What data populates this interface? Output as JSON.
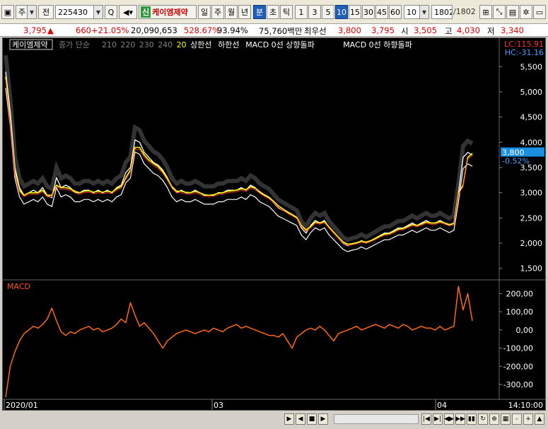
{
  "toolbar": {
    "market_label": "주",
    "jeon_label": "전",
    "code": "225430",
    "sin_label": "신",
    "stock_name": "케이엠제약",
    "period_tabs": [
      "일",
      "주",
      "월",
      "년",
      "분",
      "초",
      "틱"
    ],
    "active_period": "분",
    "interval_buttons": [
      "1",
      "3",
      "5",
      "10",
      "15",
      "30",
      "45",
      "60"
    ],
    "active_interval": "10",
    "interval_select": "10",
    "count_value": "1802",
    "count_total": "/1802"
  },
  "quote": {
    "price": "3,795",
    "up_arrow": "▲",
    "change": "660",
    "change_pct": "+21.05%",
    "volume": "20,090,653",
    "volume_pct": "528.67%",
    "ratio_pct": "93.94%",
    "amount": "75,760백만",
    "best_bid_label": "최우선",
    "best_bid": "3,800",
    "best_ask": "3,795",
    "open_label": "시",
    "open": "3,505",
    "high_label": "고",
    "high": "4,030",
    "low_label": "저",
    "low": "3,340"
  },
  "chart_data": [
    {
      "type": "line",
      "panel": "price",
      "legend": [
        "케이엠제약",
        "종가 단순",
        "210",
        "220",
        "230",
        "240",
        "20",
        "상한선",
        "하한선",
        "MACD 0선 상향돌파",
        "MACD 0선 하향돌파"
      ],
      "ylim": [
        1300,
        5700
      ],
      "y_ticks": [
        1500,
        2000,
        2500,
        3000,
        3500,
        4000,
        4500,
        5000,
        5500
      ],
      "y_tick_labels": [
        "1,500",
        "2,000",
        "2,500",
        "3,000",
        "3,500",
        "4,000",
        "4,500",
        "5,000",
        "5,500"
      ],
      "lc_label": "LC:115.91",
      "hc_label": "HC:-31.16",
      "current_price_label": "3,800",
      "current_pct_label": "-0.52%",
      "x_labels": [
        "2020/01",
        "03",
        "04"
      ],
      "time_label": "14:10:00",
      "series": [
        {
          "color": "#ffffff",
          "values": [
            5400,
            4600,
            3500,
            3100,
            2950,
            3000,
            3050,
            3000,
            3100,
            2950,
            2900,
            3300,
            3100,
            3150,
            3100,
            3000,
            3000,
            3050,
            3050,
            3000,
            3050,
            3000,
            3050,
            3000,
            3100,
            3150,
            3400,
            3500,
            4050,
            4000,
            3800,
            3700,
            3600,
            3550,
            3450,
            3300,
            3100,
            3000,
            3050,
            3000,
            3000,
            3050,
            3000,
            2950,
            2950,
            2950,
            3000,
            3000,
            3050,
            3050,
            3050,
            3100,
            3050,
            3150,
            3100,
            3000,
            2950,
            2900,
            2800,
            2700,
            2650,
            2600,
            2550,
            2500,
            2300,
            2200,
            2350,
            2450,
            2400,
            2450,
            2300,
            2200,
            2100,
            2000,
            1950,
            1980,
            2000,
            2050,
            2000,
            2050,
            2100,
            2150,
            2200,
            2200,
            2250,
            2300,
            2300,
            2350,
            2400,
            2350,
            2400,
            2450,
            2400,
            2400,
            2450,
            2400,
            2350,
            2400,
            3000,
            3700,
            3800,
            3750
          ]
        },
        {
          "color": "#ffff00",
          "values": [
            5300,
            4400,
            3400,
            3050,
            2950,
            3000,
            3000,
            3000,
            3050,
            2950,
            2950,
            3150,
            3100,
            3100,
            3080,
            3030,
            3000,
            3030,
            3040,
            3010,
            3030,
            3010,
            3030,
            3010,
            3080,
            3120,
            3300,
            3450,
            3900,
            3900,
            3750,
            3650,
            3580,
            3520,
            3420,
            3280,
            3120,
            3030,
            3030,
            3010,
            3000,
            3030,
            3000,
            2960,
            2950,
            2960,
            2990,
            3000,
            3030,
            3040,
            3050,
            3080,
            3060,
            3120,
            3090,
            3020,
            2960,
            2910,
            2830,
            2740,
            2680,
            2620,
            2570,
            2510,
            2350,
            2260,
            2330,
            2420,
            2400,
            2430,
            2320,
            2220,
            2120,
            2030,
            1980,
            1990,
            2010,
            2040,
            2020,
            2050,
            2090,
            2140,
            2180,
            2190,
            2230,
            2280,
            2290,
            2330,
            2370,
            2350,
            2380,
            2420,
            2400,
            2400,
            2430,
            2400,
            2370,
            2390,
            3000,
            3150,
            3700,
            3780
          ]
        }
      ]
    },
    {
      "type": "line",
      "panel": "macd",
      "title": "MACD",
      "ylim": [
        -370,
        260
      ],
      "y_ticks": [
        200,
        100,
        0,
        -100,
        -200,
        -300
      ],
      "y_tick_labels": [
        "200,00",
        "100,00",
        "0,00",
        "-100,00",
        "-200,00",
        "-300,00"
      ],
      "series": [
        {
          "name": "MACD",
          "color": "#ff6a10",
          "values": [
            -370,
            -200,
            -120,
            -60,
            -20,
            0,
            20,
            10,
            30,
            60,
            120,
            50,
            -10,
            -30,
            -10,
            -20,
            0,
            10,
            20,
            0,
            10,
            -10,
            0,
            10,
            30,
            60,
            40,
            150,
            80,
            20,
            40,
            10,
            -20,
            -60,
            -100,
            -60,
            -40,
            -20,
            -10,
            0,
            -10,
            -20,
            -10,
            0,
            -10,
            10,
            0,
            -10,
            10,
            20,
            30,
            10,
            20,
            10,
            0,
            -10,
            -20,
            -30,
            -30,
            -40,
            -20,
            -60,
            -100,
            -40,
            -20,
            0,
            10,
            0,
            20,
            0,
            -30,
            -60,
            -20,
            -10,
            0,
            10,
            20,
            0,
            10,
            20,
            30,
            20,
            10,
            30,
            20,
            10,
            30,
            20,
            0,
            10,
            20,
            10,
            10,
            0,
            20,
            0,
            10,
            20,
            240,
            110,
            200,
            50
          ]
        }
      ]
    }
  ],
  "scroll": {
    "buttons": [
      "▶",
      "◀",
      "■",
      "▶",
      "-",
      "+",
      "▲"
    ]
  },
  "colors": {
    "accent_blue": "#1f5fb8",
    "up_red": "#e00000",
    "macd_orange": "#ff6a10"
  }
}
